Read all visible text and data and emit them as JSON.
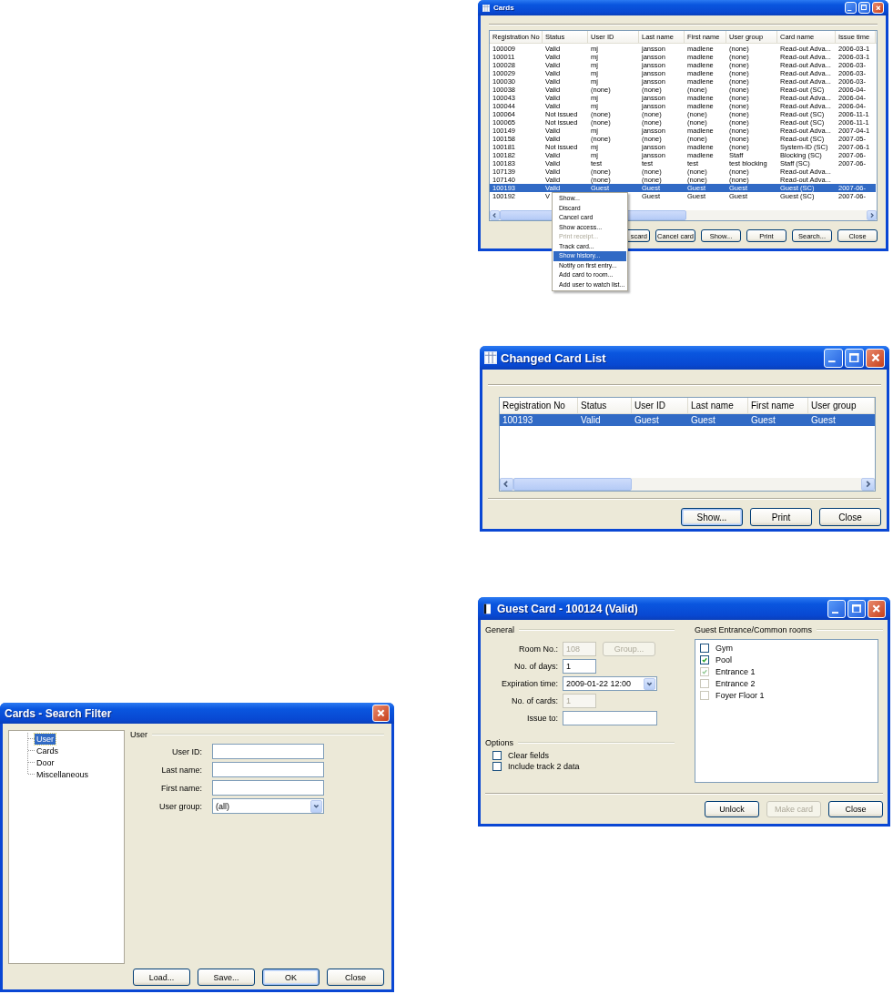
{
  "cards_window": {
    "title": "Cards",
    "table": {
      "columns": [
        "Registration No",
        "Status",
        "User ID",
        "Last name",
        "First name",
        "User group",
        "Card name",
        "Issue time"
      ],
      "rows": [
        {
          "cells": [
            "100009",
            "Valid",
            "mj",
            "jansson",
            "madlene",
            "(none)",
            "Read-out Adva...",
            "2006-03-1"
          ],
          "selected": false
        },
        {
          "cells": [
            "100011",
            "Valid",
            "mj",
            "jansson",
            "madlene",
            "(none)",
            "Read-out Adva...",
            "2006-03-1"
          ],
          "selected": false
        },
        {
          "cells": [
            "100028",
            "Valid",
            "mj",
            "jansson",
            "madlene",
            "(none)",
            "Read-out Adva...",
            "2006-03-"
          ],
          "selected": false
        },
        {
          "cells": [
            "100029",
            "Valid",
            "mj",
            "jansson",
            "madlene",
            "(none)",
            "Read-out Adva...",
            "2006-03-"
          ],
          "selected": false
        },
        {
          "cells": [
            "100030",
            "Valid",
            "mj",
            "jansson",
            "madlene",
            "(none)",
            "Read-out Adva...",
            "2006-03-"
          ],
          "selected": false
        },
        {
          "cells": [
            "100038",
            "Valid",
            "(none)",
            "(none)",
            "(none)",
            "(none)",
            "Read-out (SC)",
            "2006-04-"
          ],
          "selected": false
        },
        {
          "cells": [
            "100043",
            "Valid",
            "mj",
            "jansson",
            "madlene",
            "(none)",
            "Read-out Adva...",
            "2006-04-"
          ],
          "selected": false
        },
        {
          "cells": [
            "100044",
            "Valid",
            "mj",
            "jansson",
            "madlene",
            "(none)",
            "Read-out Adva...",
            "2006-04-"
          ],
          "selected": false
        },
        {
          "cells": [
            "100064",
            "Not issued",
            "(none)",
            "(none)",
            "(none)",
            "(none)",
            "Read-out (SC)",
            "2006-11-1"
          ],
          "selected": false
        },
        {
          "cells": [
            "100065",
            "Not issued",
            "(none)",
            "(none)",
            "(none)",
            "(none)",
            "Read-out (SC)",
            "2006-11-1"
          ],
          "selected": false
        },
        {
          "cells": [
            "100149",
            "Valid",
            "mj",
            "jansson",
            "madlene",
            "(none)",
            "Read-out Adva...",
            "2007-04-1"
          ],
          "selected": false
        },
        {
          "cells": [
            "100158",
            "Valid",
            "(none)",
            "(none)",
            "(none)",
            "(none)",
            "Read-out (SC)",
            "2007-05-"
          ],
          "selected": false
        },
        {
          "cells": [
            "100181",
            "Not issued",
            "mj",
            "jansson",
            "madlene",
            "(none)",
            "System-ID (SC)",
            "2007-06-1"
          ],
          "selected": false
        },
        {
          "cells": [
            "100182",
            "Valid",
            "mj",
            "jansson",
            "madlene",
            "Staff",
            "Blocking (SC)",
            "2007-06-"
          ],
          "selected": false
        },
        {
          "cells": [
            "100183",
            "Valid",
            "test",
            "test",
            "test",
            "test blocking",
            "Staff (SC)",
            "2007-06-"
          ],
          "selected": false
        },
        {
          "cells": [
            "107139",
            "Valid",
            "(none)",
            "(none)",
            "(none)",
            "(none)",
            "Read-out Adva...",
            null
          ],
          "selected": false
        },
        {
          "cells": [
            "107140",
            "Valid",
            "(none)",
            "(none)",
            "(none)",
            "(none)",
            "Read-out Adva...",
            null
          ],
          "selected": false
        },
        {
          "cells": [
            "100193",
            "Valid",
            "Guest",
            "Guest",
            "Guest",
            "Guest",
            "Guest (SC)",
            "2007-06-"
          ],
          "selected": true
        },
        {
          "cells": [
            "100192",
            "V",
            null,
            "Guest",
            "Guest",
            "Guest",
            "Guest (SC)",
            "2007-06-"
          ],
          "selected": false
        }
      ]
    },
    "buttons": [
      "scard",
      "Cancel card",
      "Show...",
      "Print",
      "Search...",
      "Close"
    ],
    "context_menu": {
      "items": [
        {
          "label": "Show...",
          "disabled": false,
          "selected": false
        },
        {
          "label": "Discard",
          "disabled": false,
          "selected": false
        },
        {
          "label": "Cancel card",
          "disabled": false,
          "selected": false
        },
        {
          "label": "Show access...",
          "disabled": false,
          "selected": false
        },
        {
          "label": "Print receipt...",
          "disabled": true,
          "selected": false
        },
        {
          "label": "Track card...",
          "disabled": false,
          "selected": false
        },
        {
          "label": "Show history...",
          "disabled": false,
          "selected": true
        },
        {
          "label": "Notify on first entry...",
          "disabled": false,
          "selected": false
        },
        {
          "label": "Add card to room...",
          "disabled": false,
          "selected": false
        },
        {
          "label": "Add user to watch list...",
          "disabled": false,
          "selected": false
        }
      ]
    }
  },
  "changed_card_list": {
    "title": "Changed Card List",
    "table": {
      "columns": [
        "Registration No",
        "Status",
        "User ID",
        "Last name",
        "First name",
        "User group"
      ],
      "rows": [
        {
          "cells": [
            "100193",
            "Valid",
            "Guest",
            "Guest",
            "Guest",
            "Guest"
          ],
          "selected": true
        }
      ]
    },
    "buttons": [
      {
        "label": "Show...",
        "default": true,
        "disabled": false
      },
      {
        "label": "Print",
        "default": false,
        "disabled": false
      },
      {
        "label": "Close",
        "default": false,
        "disabled": false
      }
    ]
  },
  "guest_card": {
    "title": "Guest Card  - 100124 (Valid)",
    "general": {
      "title": "General",
      "fields": [
        {
          "label": "Room No.:",
          "kind": "short",
          "value": "108",
          "disabled": true,
          "button": {
            "label": "Group...",
            "disabled": true
          }
        },
        {
          "label": "No. of days:",
          "kind": "short",
          "value": "1",
          "disabled": false
        },
        {
          "label": "Expiration time:",
          "kind": "dropdown",
          "value": "2009-01-22 12:00",
          "disabled": false
        },
        {
          "label": "No. of cards:",
          "kind": "short",
          "value": "1",
          "disabled": true
        },
        {
          "label": "Issue to:",
          "kind": "wide",
          "disabled": false
        }
      ]
    },
    "options": {
      "title": "Options",
      "items": [
        {
          "label": "Clear fields",
          "checked": false
        },
        {
          "label": "Include track 2 data",
          "checked": false
        }
      ]
    },
    "rooms": {
      "title": "Guest Entrance/Common rooms",
      "items": [
        {
          "label": "Gym",
          "checked": false,
          "disabled": false
        },
        {
          "label": "Pool",
          "checked": true,
          "disabled": false
        },
        {
          "label": "Entrance 1",
          "checked": true,
          "disabled": true
        },
        {
          "label": "Entrance 2",
          "checked": false,
          "disabled": true
        },
        {
          "label": "Foyer Floor 1",
          "checked": false,
          "disabled": true
        }
      ]
    },
    "buttons": [
      {
        "label": "Unlock",
        "default": false,
        "disabled": false
      },
      {
        "label": "Make card",
        "default": false,
        "disabled": true
      },
      {
        "label": "Close",
        "default": false,
        "disabled": false
      }
    ]
  },
  "search_filter": {
    "title": "Cards - Search Filter",
    "tree": [
      {
        "label": "User",
        "selected": true
      },
      {
        "label": "Cards",
        "selected": false
      },
      {
        "label": "Door",
        "selected": false
      },
      {
        "label": "Miscellaneous",
        "selected": false
      }
    ],
    "group": "User",
    "fields": [
      {
        "label": "User ID:",
        "kind": "wide",
        "disabled": false
      },
      {
        "label": "Last name:",
        "kind": "wide",
        "disabled": false
      },
      {
        "label": "First name:",
        "kind": "wide",
        "disabled": false
      },
      {
        "label": "User group:",
        "kind": "dropdown",
        "value": "(all)",
        "disabled": false
      }
    ],
    "buttons": [
      {
        "label": "Load...",
        "default": false,
        "disabled": false
      },
      {
        "label": "Save...",
        "default": false,
        "disabled": false
      },
      {
        "label": "OK",
        "default": true,
        "disabled": false
      },
      {
        "label": "Close",
        "default": false,
        "disabled": false
      }
    ]
  }
}
